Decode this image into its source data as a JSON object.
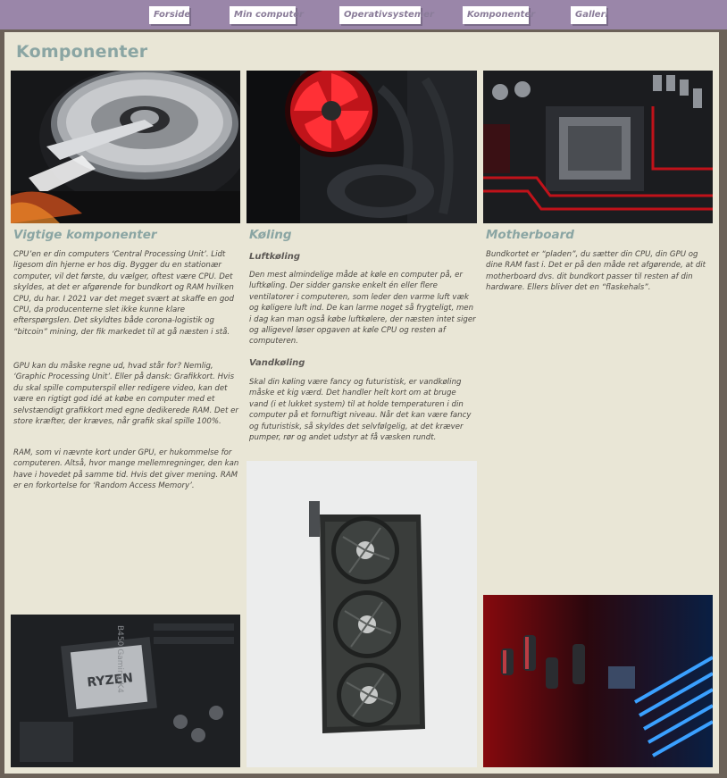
{
  "nav": {
    "items": [
      {
        "label": "Forside"
      },
      {
        "label": "Min computer"
      },
      {
        "label": "Operativsystemer"
      },
      {
        "label": "Komponenter"
      },
      {
        "label": "Galleri"
      }
    ]
  },
  "page": {
    "title": "Komponenter"
  },
  "columns": [
    {
      "heading": "Vigtige komponenter",
      "paragraphs": [
        "CPU’en er din computers ‘Central Processing Unit’. Lidt ligesom din hjerne er hos dig. Bygger du en stationær computer, vil det første, du vælger, oftest være CPU. Det skyldes, at det er afgørende for bundkort og RAM hvilken CPU, du har. I 2021 var det meget svært at skaffe en god CPU, da producenterne slet ikke kunne klare efterspørgslen. Det skyldtes både corona-logistik og “bitcoin” mining, der fik markedet til at gå næsten i stå.",
        "GPU kan du måske regne ud, hvad står for? Nemlig, ‘Graphic Processing Unit’. Eller på dansk: Grafikkort. Hvis du skal spille computerspil eller redigere video, kan det være en rigtigt god idé at købe en computer med et selvstændigt grafikkort med egne dedikerede RAM. Det er store kræfter, der kræves, når grafik skal spille 100%.",
        "RAM, som vi nævnte kort under GPU, er hukommelse for computeren. Altså, hvor mange mellemregninger, den kan have i hovedet på samme tid. Hvis det giver mening. RAM er en forkortelse for ‘Random Access Memory’."
      ]
    },
    {
      "heading": "Køling",
      "sections": [
        {
          "subheading": "Luftkøling",
          "text": "Den mest almindelige måde at køle en computer på, er luftkøling. Der sidder ganske enkelt én eller flere ventilatorer i computeren, som leder den varme luft væk og køligere luft ind. De kan larme noget så frygteligt, men i dag kan man også købe luftkølere, der næsten intet siger og alligevel løser opgaven at køle CPU og resten af computeren."
        },
        {
          "subheading": "Vandkøling",
          "text": "Skal din køling være fancy og futuristisk, er vandkøling måske et kig værd. Det handler helt kort om at bruge vand (i et lukket system) til at holde temperaturen i din computer på et fornuftigt niveau. Når det kan være fancy og futuristisk, så skyldes det selvfølgelig, at det kræver pumper, rør og andet udstyr at få væsken rundt."
        }
      ]
    },
    {
      "heading": "Motherboard",
      "paragraphs": [
        "Bundkortet er “pladen”, du sætter din CPU, din GPU og dine RAM fast i. Det er på den måde ret afgørende, at dit motherboard dvs. dit bundkort passer til resten af din hardware. Ellers bliver det en “flaskehals”."
      ]
    }
  ],
  "photos": {
    "cpu_chip_label": "RYZEN",
    "board_label": "B450 Gaming K4"
  },
  "colors": {
    "nav_bg": "#9a86a9",
    "page_bg": "#e9e6d6",
    "outer_bg": "#6b6158",
    "heading": "#8aa5a3",
    "text": "#4a4742"
  }
}
